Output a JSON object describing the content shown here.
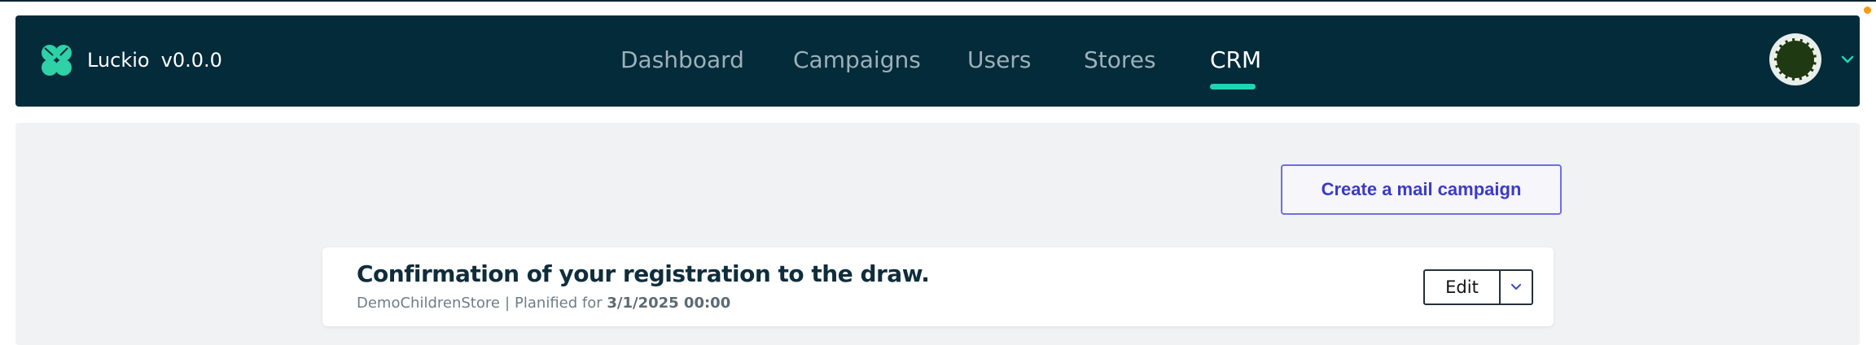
{
  "app": {
    "name": "Luckio",
    "version": "v0.0.0",
    "logo_icon": "clover-icon"
  },
  "nav": {
    "items": [
      {
        "label": "Dashboard",
        "active": false
      },
      {
        "label": "Campaigns",
        "active": false
      },
      {
        "label": "Users",
        "active": false
      },
      {
        "label": "Stores",
        "active": false
      },
      {
        "label": "CRM",
        "active": true
      }
    ]
  },
  "user_menu": {
    "avatar_icon": "avatar-icon",
    "dropdown_icon": "chevron-down-icon"
  },
  "actions": {
    "create_mail_campaign": "Create a mail campaign"
  },
  "campaigns": [
    {
      "title": "Confirmation of your registration to the draw.",
      "store": "DemoChildrenStore",
      "separator": "|",
      "planned_label": "Planified for",
      "planned_date": "3/1/2025 00:00",
      "edit_label": "Edit"
    }
  ],
  "colors": {
    "navbar_bg": "#032b3a",
    "accent": "#1fd6b2",
    "primary_button": "#3b3bc9",
    "content_bg": "#f1f2f4"
  }
}
